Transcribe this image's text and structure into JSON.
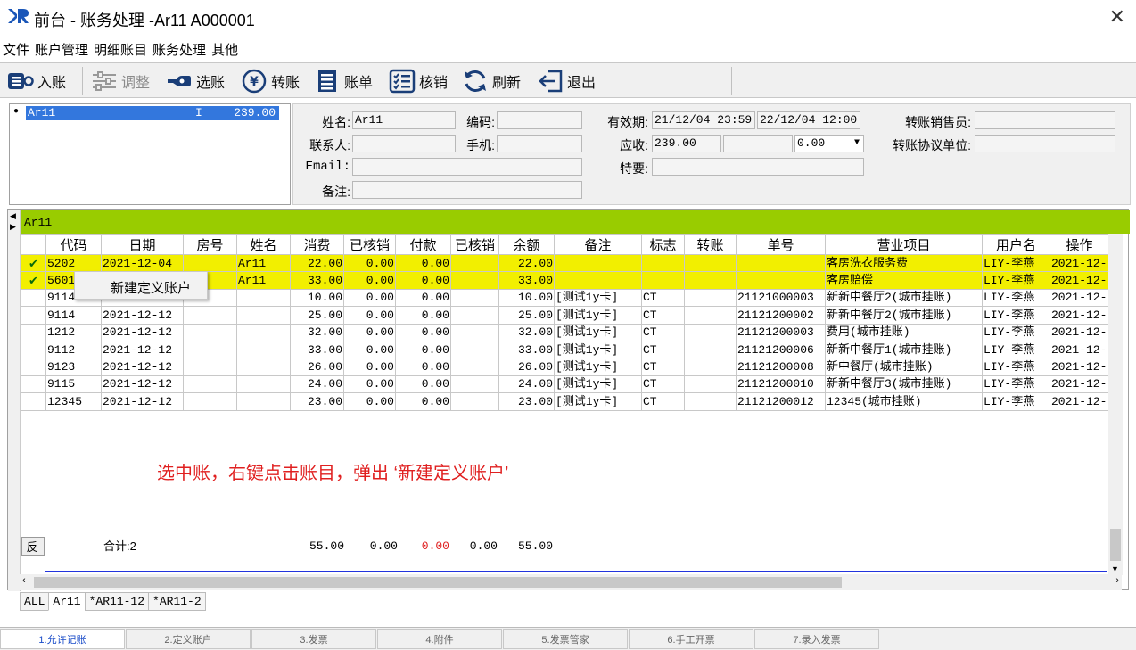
{
  "window": {
    "title": "前台 - 账务处理 -Ar11  A000001"
  },
  "menu": [
    "文件",
    "账户管理",
    "明细账目",
    "账务处理",
    "其他"
  ],
  "toolbar": [
    {
      "label": "入账",
      "icon": "post-entry-icon",
      "enabled": true
    },
    {
      "label": "调整",
      "icon": "adjust-sliders-icon",
      "enabled": false
    },
    {
      "label": "选账",
      "icon": "select-account-icon",
      "enabled": true
    },
    {
      "label": "转账",
      "icon": "transfer-yen-icon",
      "enabled": true
    },
    {
      "label": "账单",
      "icon": "bill-icon",
      "enabled": true
    },
    {
      "label": "核销",
      "icon": "writeoff-list-icon",
      "enabled": true
    },
    {
      "label": "刷新",
      "icon": "refresh-icon",
      "enabled": true
    },
    {
      "label": "退出",
      "icon": "exit-icon",
      "enabled": true
    }
  ],
  "account_list": [
    {
      "name": "Ar11",
      "flag": "I",
      "amount": "239.00"
    }
  ],
  "info": {
    "name_label": "姓名:",
    "name": "Ar11",
    "code_label": "编码:",
    "code": "",
    "valid_label": "有效期:",
    "valid_from": "21/12/04 23:59",
    "valid_to": "22/12/04 12:00",
    "transfer_sales_label": "转账销售员:",
    "transfer_sales": "",
    "contact_label": "联系人:",
    "contact": "",
    "mobile_label": "手机:",
    "mobile": "",
    "receivable_label": "应收:",
    "receivable": "239.00",
    "receivable2": "",
    "receivable3": "0.00",
    "transfer_unit_label": "转账协议单位:",
    "transfer_unit": "",
    "email_label": "Email:",
    "email": "",
    "special_label": "特要:",
    "special": "",
    "remark_label": "备注:",
    "remark": ""
  },
  "grid": {
    "group": "Ar11",
    "columns": [
      "代码",
      "日期",
      "房号",
      "姓名",
      "消费",
      "已核销",
      "付款",
      "已核销",
      "余额",
      "备注",
      "标志",
      "转账",
      "单号",
      "营业项目",
      "用户名",
      "操作"
    ],
    "rows": [
      {
        "checked": true,
        "hl": true,
        "cells": [
          "5202",
          "2021-12-04",
          "",
          "Ar11",
          "22.00",
          "0.00",
          "0.00",
          "",
          "22.00",
          "",
          "",
          "",
          "",
          "客房洗衣服务费",
          "LIY-李燕",
          "2021-12-"
        ]
      },
      {
        "checked": true,
        "hl": true,
        "cells": [
          "5601",
          "",
          "",
          "Ar11",
          "33.00",
          "0.00",
          "0.00",
          "",
          "33.00",
          "",
          "",
          "",
          "",
          "客房赔偿",
          "LIY-李燕",
          "2021-12-"
        ]
      },
      {
        "checked": false,
        "hl": false,
        "cells": [
          "9114",
          "",
          "",
          "",
          "10.00",
          "0.00",
          "0.00",
          "",
          "10.00",
          "[测试1y卡]",
          "CT",
          "",
          "21121000003",
          "新新中餐厅2(城市挂账)",
          "LIY-李燕",
          "2021-12-"
        ]
      },
      {
        "checked": false,
        "hl": false,
        "cells": [
          "9114",
          "2021-12-12",
          "",
          "",
          "25.00",
          "0.00",
          "0.00",
          "",
          "25.00",
          "[测试1y卡]",
          "CT",
          "",
          "21121200002",
          "新新中餐厅2(城市挂账)",
          "LIY-李燕",
          "2021-12-"
        ]
      },
      {
        "checked": false,
        "hl": false,
        "cells": [
          "1212",
          "2021-12-12",
          "",
          "",
          "32.00",
          "0.00",
          "0.00",
          "",
          "32.00",
          "[测试1y卡]",
          "CT",
          "",
          "21121200003",
          "费用(城市挂账)",
          "LIY-李燕",
          "2021-12-"
        ]
      },
      {
        "checked": false,
        "hl": false,
        "cells": [
          "9112",
          "2021-12-12",
          "",
          "",
          "33.00",
          "0.00",
          "0.00",
          "",
          "33.00",
          "[测试1y卡]",
          "CT",
          "",
          "21121200006",
          "新新中餐厅1(城市挂账)",
          "LIY-李燕",
          "2021-12-"
        ]
      },
      {
        "checked": false,
        "hl": false,
        "cells": [
          "9123",
          "2021-12-12",
          "",
          "",
          "26.00",
          "0.00",
          "0.00",
          "",
          "26.00",
          "[测试1y卡]",
          "CT",
          "",
          "21121200008",
          "新中餐厅(城市挂账)",
          "LIY-李燕",
          "2021-12-"
        ]
      },
      {
        "checked": false,
        "hl": false,
        "cells": [
          "9115",
          "2021-12-12",
          "",
          "",
          "24.00",
          "0.00",
          "0.00",
          "",
          "24.00",
          "[测试1y卡]",
          "CT",
          "",
          "21121200010",
          "新新中餐厅3(城市挂账)",
          "LIY-李燕",
          "2021-12-"
        ]
      },
      {
        "checked": false,
        "hl": false,
        "cells": [
          "12345",
          "2021-12-12",
          "",
          "",
          "23.00",
          "0.00",
          "0.00",
          "",
          "23.00",
          "[测试1y卡]",
          "CT",
          "",
          "21121200012",
          "12345(城市挂账)",
          "LIY-李燕",
          "2021-12-"
        ]
      }
    ]
  },
  "context_menu": {
    "item": "新建定义账户"
  },
  "annotation": "选中账，右键点击账目，弹出 ‘新建定义账户’",
  "totals": {
    "reverse": "反",
    "count": "合计:2",
    "consume": "55.00",
    "written1": "0.00",
    "payment": "0.00",
    "written2": "0.00",
    "balance": "55.00",
    "payment_color": "#e02020"
  },
  "sub_tabs": [
    "ALL",
    "Ar11",
    "*AR11-12",
    "*AR11-2"
  ],
  "active_sub_tab": 1,
  "bottom_tabs": [
    "1.允许记账",
    "2.定义账户",
    "3.发票",
    "4.附件",
    "5.发票管家",
    "6.手工开票",
    "7.录入发票"
  ],
  "colors": {
    "highlight": "#f2ef00",
    "group_header": "#99cc00",
    "selection": "#3377dd",
    "annotation": "#e02020"
  }
}
